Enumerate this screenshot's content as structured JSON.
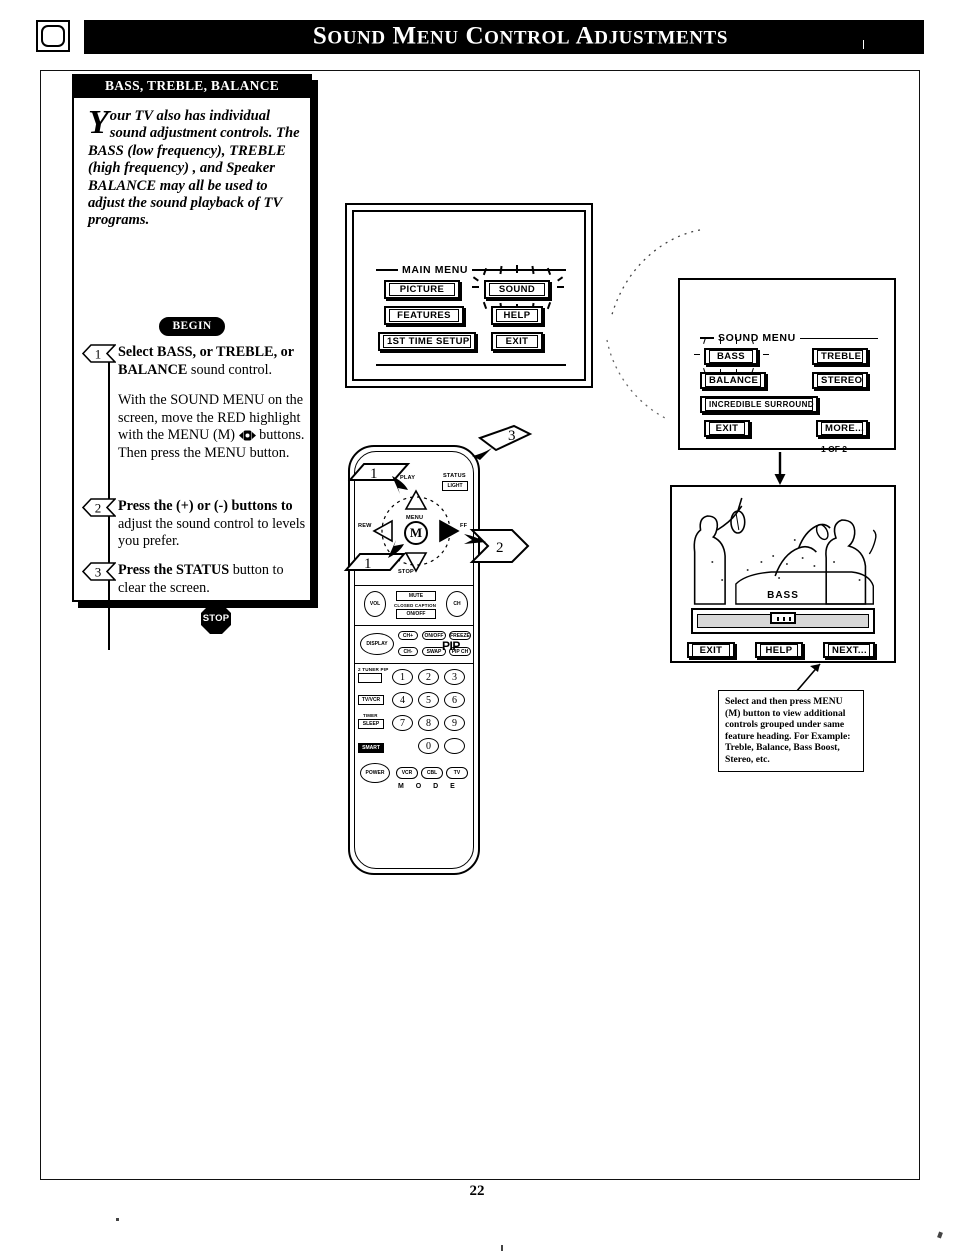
{
  "header": {
    "title_parts": [
      "S",
      "OUND",
      " M",
      "ENU",
      " C",
      "ONTROL",
      " A",
      "DJUSTMENTS"
    ],
    "title_plain": "Sound Menu Control Adjustments",
    "corner_icon": "rounded-square-icon"
  },
  "panel": {
    "title": "BASS, TREBLE, BALANCE",
    "dropcap": "Y",
    "intro": "our TV also has individual sound adjustment controls. The BASS (low frequency), TREBLE (high frequency) , and Speaker BALANCE may all be used to adjust the sound playback of TV programs.",
    "begin_label": "BEGIN",
    "stop_label": "STOP",
    "steps": [
      {
        "number": "1",
        "lead": "Select BASS, or TREBLE, or BALANCE",
        "lead_tail": " sound control.",
        "body": "With the SOUND MENU on the screen, move the RED highlight with the MENU (M) ",
        "body_tail": " buttons. Then press the MENU button.",
        "icon": "dpad-icon"
      },
      {
        "number": "2",
        "lead": "Press the (+) or (-) buttons to",
        "lead_tail": " adjust the sound control to levels you prefer.",
        "body": "",
        "body_tail": ""
      },
      {
        "number": "3",
        "lead": "Press the STATUS",
        "lead_tail": " button to clear the screen.",
        "body": "",
        "body_tail": ""
      }
    ]
  },
  "main_menu": {
    "title": "MAIN MENU",
    "buttons": [
      {
        "label": "PICTURE",
        "highlighted": false
      },
      {
        "label": "SOUND",
        "highlighted": true
      },
      {
        "label": "FEATURES",
        "highlighted": false
      },
      {
        "label": "HELP",
        "highlighted": false
      },
      {
        "label": "1ST TIME SETUP",
        "highlighted": false
      },
      {
        "label": "EXIT",
        "highlighted": false
      }
    ]
  },
  "sound_menu": {
    "title": "SOUND MENU",
    "page_indicator": "1 OF 2",
    "buttons": [
      {
        "label": "BASS",
        "highlighted": true
      },
      {
        "label": "TREBLE",
        "highlighted": false
      },
      {
        "label": "BALANCE",
        "highlighted": false
      },
      {
        "label": "STEREO",
        "highlighted": false
      },
      {
        "label": "INCREDIBLE SURROUND",
        "highlighted": false
      },
      {
        "label": "EXIT",
        "highlighted": false
      },
      {
        "label": "MORE...",
        "highlighted": false
      }
    ]
  },
  "bass_screen": {
    "scene": "jazz-band-silhouette",
    "slider_label": "BASS",
    "slider_value_percent": 50,
    "buttons": [
      {
        "label": "EXIT"
      },
      {
        "label": "HELP"
      },
      {
        "label": "NEXT..."
      }
    ]
  },
  "caption": {
    "text": "Select and then press MENU (M) button to view additional controls grouped under same feature heading. For Example: Treble, Balance, Bass Boost, Stereo, etc."
  },
  "remote": {
    "center_key": "M",
    "callouts": [
      "1",
      "1",
      "2",
      "3"
    ],
    "labels": {
      "play": "PLAY",
      "status": "STATUS",
      "light": "LIGHT",
      "rew": "REW",
      "ff": "FF",
      "stop": "STOP",
      "menu": "MENU",
      "vol": "VOL",
      "ch": "CH",
      "mute": "MUTE",
      "cc_onoff": "ON/OFF",
      "cc": "CLOSED CAPTION",
      "display": "DISPLAY",
      "ch_up": "CH+",
      "ch_dn": "CH-",
      "pip_onoff": "ON/OFF",
      "freeze": "FREEZE",
      "swap": "SWAP",
      "pip_ch": "PIP CH",
      "pip": "PIP",
      "tuner_pip": "2 TUNER PIP",
      "tv_vcr": "TV/VCR",
      "sleep": "SLEEP",
      "timer": "TIMER",
      "smart": "SMART",
      "power": "POWER",
      "mode": "M O D E"
    },
    "mode_buttons": [
      "VCR",
      "CBL",
      "TV"
    ],
    "keypad": [
      "1",
      "2",
      "3",
      "4",
      "5",
      "6",
      "7",
      "8",
      "9",
      "0"
    ]
  },
  "footer": {
    "page_number": "22"
  },
  "colors": {
    "ink": "#000000",
    "paper": "#ffffff",
    "slider_track": "#d8d8d8"
  }
}
